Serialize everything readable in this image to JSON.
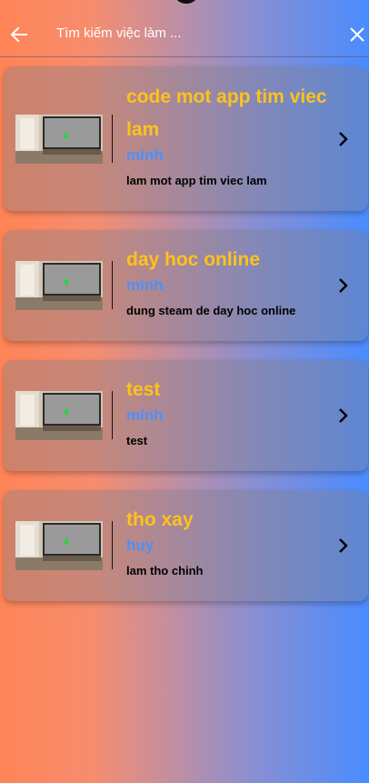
{
  "appbar": {
    "title": "Tìm kiếm việc làm ...",
    "back_icon": "arrow-left-icon",
    "close_icon": "close-icon"
  },
  "jobs": [
    {
      "title": "code mot app tim viec lam",
      "user": "minh",
      "description": "lam mot app tim viec lam"
    },
    {
      "title": "day hoc online",
      "user": "minh",
      "description": "dung steam de day hoc online"
    },
    {
      "title": "test",
      "user": "minh",
      "description": "test"
    },
    {
      "title": "tho xay",
      "user": "huy",
      "description": "lam tho chinh"
    }
  ],
  "colors": {
    "title": "#ffc21a",
    "user": "#4a90ff",
    "gradient_left": "#ff8456",
    "gradient_right": "#4a8cff"
  }
}
